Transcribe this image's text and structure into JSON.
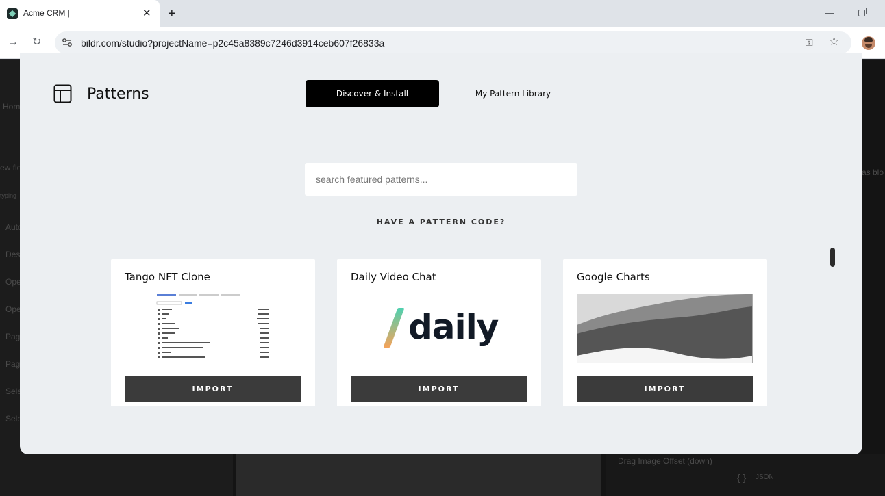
{
  "browser": {
    "tab_title": "Acme CRM |",
    "tab_close": "✕",
    "new_tab": "+",
    "url": "bildr.com/studio?projectName=p2c45a8389c7246d3914ceb607f26833a"
  },
  "background": {
    "left_items": [
      "Hom",
      "ew flo",
      "typing",
      "Auto",
      "Desc",
      "Ope",
      "Ope",
      "Page",
      "Page",
      "Sele",
      "Sele"
    ],
    "right_text": "as blo",
    "bottom_label": "Drag Image Offset (down)",
    "json_label": "JSON",
    "json_braces": "{ }"
  },
  "modal": {
    "title": "Patterns",
    "tabs": {
      "discover": "Discover & Install",
      "library": "My Pattern Library"
    },
    "search_placeholder": "search featured patterns...",
    "pattern_code_label": "HAVE A PATTERN CODE?",
    "cards": [
      {
        "title": "Tango NFT Clone",
        "button": "IMPORT",
        "thumb": "table-screenshot"
      },
      {
        "title": "Daily Video Chat",
        "button": "IMPORT",
        "thumb": "daily-logo",
        "logo_text": "daily"
      },
      {
        "title": "Google Charts",
        "button": "IMPORT",
        "thumb": "area-chart"
      }
    ]
  },
  "colors": {
    "modal_bg": "#eceff2",
    "primary_tab_bg": "#000000",
    "import_button_bg": "#3b3b3b"
  }
}
